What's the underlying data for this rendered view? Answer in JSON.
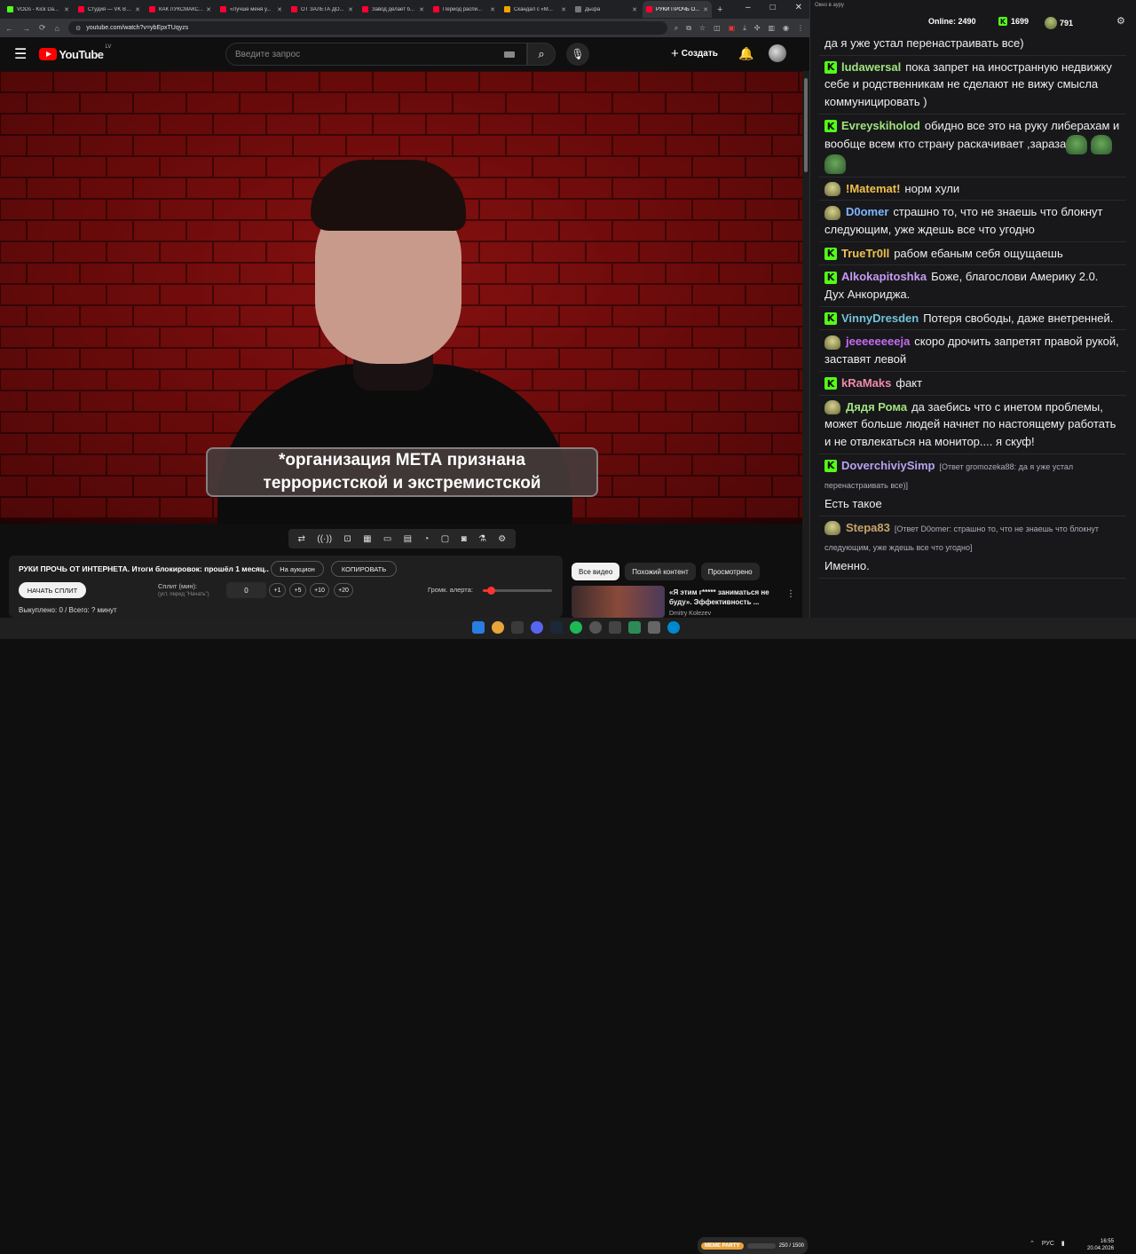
{
  "browser": {
    "tabs": [
      {
        "label": "VODs - Kick Da...",
        "fav": "green"
      },
      {
        "label": "Студия — VK Ви...",
        "fav": "red"
      },
      {
        "label": "КАК ЛУКСМАКС...",
        "fav": "red"
      },
      {
        "label": "«Лучше меня у...",
        "fav": "red"
      },
      {
        "label": "ОТ ЗАЛЕТА ДО...",
        "fav": "red"
      },
      {
        "label": "Завод делает б...",
        "fav": "red"
      },
      {
        "label": "Период распи...",
        "fav": "red"
      },
      {
        "label": "Скандал с «М...",
        "fav": "orange"
      },
      {
        "label": "Дьüра",
        "fav": "gray"
      },
      {
        "label": "РУКИ ПРОЧЬ О...",
        "fav": "red",
        "active": true
      }
    ],
    "url": "youtube.com/watch?v=ybEpxTUqyzs"
  },
  "youtube": {
    "logo_text": "YouTube",
    "country": "LV",
    "search_placeholder": "Введите запрос",
    "create_label": "Создать"
  },
  "video": {
    "caption_line1": "*организация МЕТА признана",
    "caption_line2": "террористской и экстремистской"
  },
  "panel": {
    "title": "РУКИ ПРОЧЬ ОТ ИНТЕРНЕТА. Итоги блокировок: прошёл 1 месяц...",
    "auction_label": "На аукцион",
    "copy_label": "КОПИРОВАТЬ",
    "start_split_label": "НАЧАТЬ СПЛИТ",
    "split_label": "Сплит (мин):",
    "split_sub": "(уст. перед \"Начать\")",
    "split_value": "0",
    "steps": [
      "+1",
      "+5",
      "+10",
      "+20"
    ],
    "alert_label": "Громк. алерта:",
    "alert_level": 0.11,
    "bought_text": "Выкуплено: 0 / Всего: ? минут"
  },
  "recs": {
    "chips": [
      "Все видео",
      "Похожий контент",
      "Просмотрено"
    ],
    "item_title": "«Я этим г***** заниматься не буду». Эффективность ...",
    "item_channel": "Dmitry Kolezev"
  },
  "chat": {
    "window_title": "Окно в ауру",
    "online_label": "Online:",
    "online_count": "2490",
    "stat1": "1699",
    "stat2": "791",
    "messages": [
      {
        "user": "",
        "color": "#efeff1",
        "badge": "none",
        "text": "да я уже устал перенастраивать все)"
      },
      {
        "user": "ludawersal",
        "color": "#a0e27c",
        "badge": "kick",
        "text": "пока запрет на иностранную недвижку себе и родственникам не сделают не вижу смысла коммуницировать )"
      },
      {
        "user": "Evreyskiholod",
        "color": "#a0e27c",
        "badge": "kick",
        "text": "обидно все это на руку либерахам и вообще всем кто страну раскачивает ,зараза",
        "emotes": 3
      },
      {
        "user": "!Matemat!",
        "color": "#f0c14b",
        "badge": "frog",
        "text": "норм хули"
      },
      {
        "user": "D0omer",
        "color": "#7fb6ff",
        "badge": "frog",
        "text": "страшно то, что не знаешь что блокнут следующим, уже ждешь все что угодно"
      },
      {
        "user": "TrueTr0ll",
        "color": "#f0c14b",
        "badge": "kick",
        "text": "рабом ебаным себя ощущаешь"
      },
      {
        "user": "Alkokapitoshka",
        "color": "#c79af2",
        "badge": "kick",
        "text": "Боже, благослови Америку 2.0. Дух Анкориджа."
      },
      {
        "user": "VinnyDresden",
        "color": "#6fc3d8",
        "badge": "kick",
        "text": "Потеря свободы, даже внетренней."
      },
      {
        "user": "jeeeeeeeeja",
        "color": "#c56bf0",
        "badge": "frog",
        "text": "скоро дрочить запретят правой рукой, заставят левой"
      },
      {
        "user": "kRaMaks",
        "color": "#f08aa8",
        "badge": "kick",
        "text": "факт"
      },
      {
        "user": "Дядя Рома",
        "color": "#a0e27c",
        "badge": "frog",
        "text": "да заебись что с инетом проблемы, может больше людей начнет по настоящему работать и не отвлекаться на монитор.... я скуф!"
      },
      {
        "user": "DoverchiviySimp",
        "color": "#b7a3f0",
        "badge": "kick",
        "reply": "[Ответ gromozeka88: да я уже устал перенастраивать все)]",
        "text": "Есть такое"
      },
      {
        "user": "Stepa83",
        "color": "#c9a36b",
        "badge": "frog",
        "reply": "[Ответ D0omer: страшно то, что не знаешь что блокнут следующим, уже ждешь все что угодно]",
        "text": "Именно."
      }
    ]
  },
  "taskbar": {
    "meme_label": "MEME PARTY",
    "meme_count": "250 / 1500",
    "lang": "РУС",
    "time": "16:55",
    "date": "20.04.2026"
  }
}
